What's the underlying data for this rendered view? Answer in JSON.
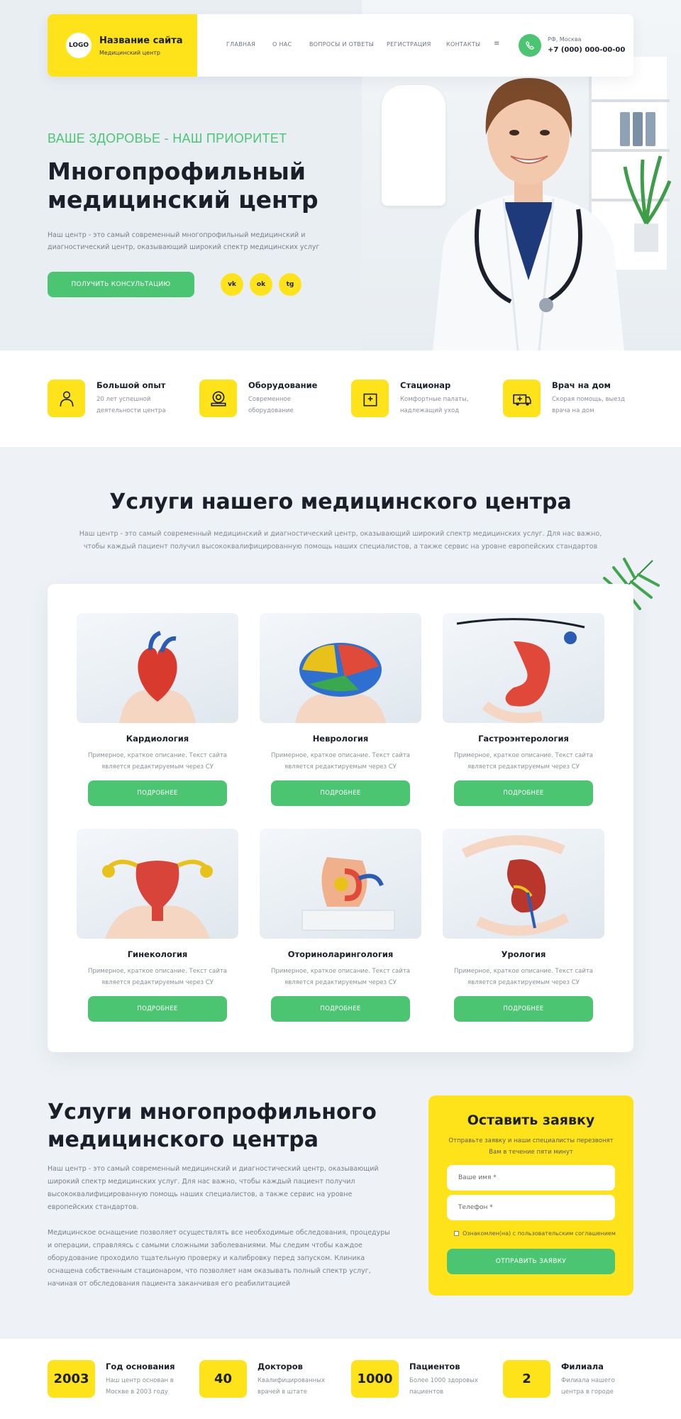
{
  "brand": {
    "logo": "LOGO",
    "name": "Название сайта",
    "subtitle": "Медицинский центр"
  },
  "nav": [
    "ГЛАВНАЯ",
    "О НАС",
    "ВОПРОСЫ И ОТВЕТЫ",
    "РЕГИСТРАЦИЯ",
    "КОНТАКТЫ"
  ],
  "nav_more_icon": "≡",
  "contact": {
    "city": "РФ, Москва",
    "phone": "+7 (000) 000-00-00",
    "icon": "phone-icon"
  },
  "hero": {
    "tagline": "ВАШЕ ЗДОРОВЬЕ - НАШ ПРИОРИТЕТ",
    "title": "Многопрофильный медицинский центр",
    "lead": "Наш центр - это самый современный многопрофильный медицинский и диагностический центр, оказывающий широкий спектр медицинских услуг",
    "cta": "ПОЛУЧИТЬ КОНСУЛЬТАЦИЮ",
    "socials": [
      "vk",
      "ok",
      "tg"
    ]
  },
  "features": [
    {
      "title": "Большой опыт",
      "text": "20 лет успешной деятельности центра",
      "icon": "doctor-icon"
    },
    {
      "title": "Оборудование",
      "text": "Современное оборудование",
      "icon": "mri-scanner-icon"
    },
    {
      "title": "Стационар",
      "text": "Комфортные палаты, надлежащий уход",
      "icon": "hospital-icon"
    },
    {
      "title": "Врач на дом",
      "text": "Скорая помощь, выезд врача на дом",
      "icon": "ambulance-icon"
    }
  ],
  "services": {
    "title": "Услуги нашего медицинского центра",
    "lead": "Наш центр - это самый современный медицинский и диагностический центр, оказывающий широкий спектр медицинских услуг. Для нас важно, чтобы каждый пациент получил высококвалифицированную помощь наших специалистов, а также сервис на уровне европейских стандартов",
    "items": [
      {
        "title": "Кардиология",
        "desc": "Примерное, краткое описание. Текст сайта является редактируемым через CУ",
        "button": "ПОДРОБНЕЕ",
        "image": "heart-model"
      },
      {
        "title": "Неврология",
        "desc": "Примерное, краткое описание. Текст сайта является редактируемым через CУ",
        "button": "ПОДРОБНЕЕ",
        "image": "brain-model"
      },
      {
        "title": "Гастроэнтерология",
        "desc": "Примерное, краткое описание. Текст сайта является редактируемым через CУ",
        "button": "ПОДРОБНЕЕ",
        "image": "stomach-model"
      },
      {
        "title": "Гинекология",
        "desc": "Примерное, краткое описание. Текст сайта является редактируемым через CУ",
        "button": "ПОДРОБНЕЕ",
        "image": "uterus-model"
      },
      {
        "title": "Оториноларингология",
        "desc": "Примерное, краткое описание. Текст сайта является редактируемым через CУ",
        "button": "ПОДРОБНЕЕ",
        "image": "ear-model"
      },
      {
        "title": "Урология",
        "desc": "Примерное, краткое описание. Текст сайта является редактируемым через CУ",
        "button": "ПОДРОБНЕЕ",
        "image": "kidney-model"
      }
    ]
  },
  "about": {
    "title": "Услуги многопрофильного медицинского центра",
    "p1": "Наш центр - это самый современный медицинский и диагностический центр, оказывающий широкий спектр медицинских услуг. Для нас важно, чтобы каждый пациент получил высококвалифицированную помощь наших специалистов, а также сервис на уровне европейских стандартов.",
    "p2": "Медицинское оснащение позволяет осуществлять все необходимые обследования, процедуры и операции, справляясь с самыми сложными заболеваниями. Мы следим чтобы каждое оборудование проходило тщательную проверку и калибровку перед запуском. Клиника оснащена собственным стационаром, что позволяет нам оказывать полный спектр услуг, начиная от обследования пациента заканчивая его реабилитацией"
  },
  "form": {
    "title": "Оставить заявку",
    "subtitle": "Отправьте заявку и наши специалисты перезвонят Вам в течение пяти минут",
    "name_placeholder": "Ваше имя *",
    "phone_placeholder": "Телефон *",
    "agree": "Ознакомлен(на) с пользовательским соглашением",
    "button": "ОТПРАВИТЬ ЗАЯВКУ"
  },
  "stats": [
    {
      "value": "2003",
      "title": "Год основания",
      "text": "Наш центр основан в Москве в 2003 году"
    },
    {
      "value": "40",
      "title": "Докторов",
      "text": "Квалифицированных врачей в штате"
    },
    {
      "value": "1000",
      "title": "Пациентов",
      "text": "Более 1000 здоровых пациентов"
    },
    {
      "value": "2",
      "title": "Филиала",
      "text": "Филиала нашего центра в городе"
    }
  ],
  "colors": {
    "accent_yellow": "#ffe31a",
    "accent_green": "#4cc572",
    "text_dark": "#1b1f2a",
    "text_muted": "#808892",
    "bg": "#eef2f6"
  }
}
